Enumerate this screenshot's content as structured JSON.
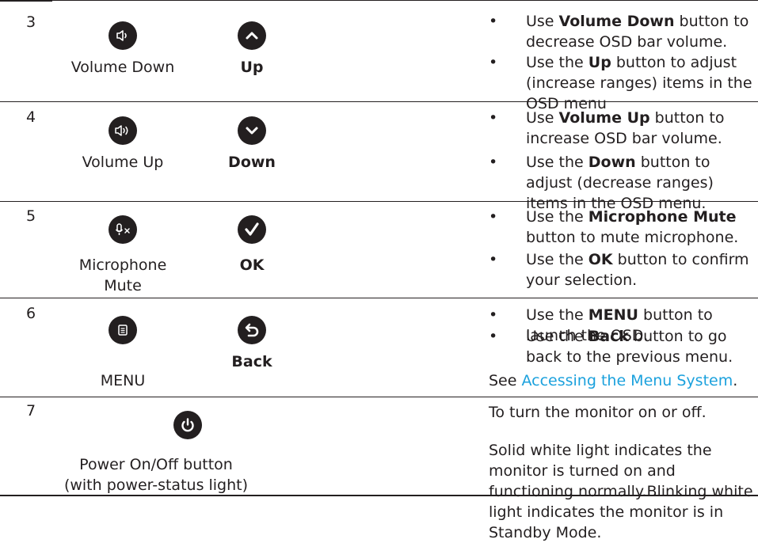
{
  "rows": [
    {
      "number": "3",
      "icon1": "volume-down-icon",
      "label1": "Volume Down",
      "icon2": "up-arrow-icon",
      "label2": "Up",
      "bullets": [
        {
          "pre": "Use ",
          "bold": "Volume Down",
          "post": " button to decrease OSD bar volume."
        },
        {
          "pre": "Use the ",
          "bold": "Up",
          "post": " button to adjust (increase ranges) items in the OSD menu"
        }
      ]
    },
    {
      "number": "4",
      "icon1": "volume-up-icon",
      "label1": "Volume Up",
      "icon2": "down-arrow-icon",
      "label2": "Down",
      "bullets": [
        {
          "pre": "Use ",
          "bold": "Volume Up",
          "post": " button to increase OSD bar volume."
        },
        {
          "pre": "Use the ",
          "bold": "Down",
          "post": " button to adjust (decrease ranges) items in the OSD menu."
        }
      ]
    },
    {
      "number": "5",
      "icon1": "microphone-mute-icon",
      "label1_line1": "Microphone",
      "label1_line2": "Mute",
      "icon2": "checkmark-icon",
      "label2": "OK",
      "bullets": [
        {
          "pre": "Use the ",
          "bold": "Microphone Mute",
          "post": " button to mute microphone."
        },
        {
          "pre": "Use the ",
          "bold": "OK",
          "post": " button to confirm your selection."
        }
      ]
    },
    {
      "number": "6",
      "icon1": "menu-icon",
      "label1": "MENU",
      "icon2": "back-arrow-icon",
      "label2": "Back",
      "bullets": [
        {
          "pre": "Use the ",
          "bold": "MENU",
          "post": " button to launch the OSD."
        },
        {
          "pre": "Use the ",
          "bold": "Back",
          "post": " button to go back to the previous menu."
        }
      ],
      "see_prefix": "See ",
      "see_link": "Accessing the Menu System",
      "see_suffix": "."
    },
    {
      "number": "7",
      "icon1": "power-icon",
      "label1_line1": "Power On/Off button",
      "label1_line2": "(with power-status light)",
      "para1": "To turn the monitor on or off.",
      "para2": "Solid white light indicates the monitor is turned on and functioning normally.Blinking white light indicates the monitor is in Standby Mode."
    }
  ],
  "bullet_char": "•",
  "colors": {
    "text": "#231f20",
    "link": "#1ba1dd"
  }
}
